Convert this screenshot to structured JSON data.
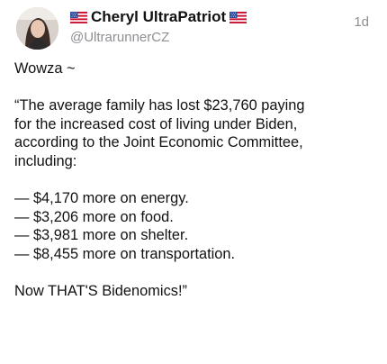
{
  "post": {
    "author": {
      "display_name": "Cheryl UltraPatriot",
      "name_decor_icon": "us-flag-icon",
      "handle": "@UltrarunnerCZ",
      "avatar": "user-avatar-photo"
    },
    "timestamp": "1d",
    "body": {
      "intro": "Wowza ~",
      "quote_lines": [
        "“The average family has lost $23,760 paying",
        "for the increased cost of living under Biden,",
        "according to the Joint Economic Committee,",
        "including:"
      ],
      "items": [
        "— $4,170 more on energy.",
        "— $3,206 more on food.",
        "— $3,981 more on shelter.",
        "— $8,455 more on transportation."
      ],
      "closing": "Now THAT'S Bidenomics!”"
    }
  },
  "colors": {
    "text": "#111111",
    "muted": "#8e8e93",
    "background": "#ffffff"
  }
}
